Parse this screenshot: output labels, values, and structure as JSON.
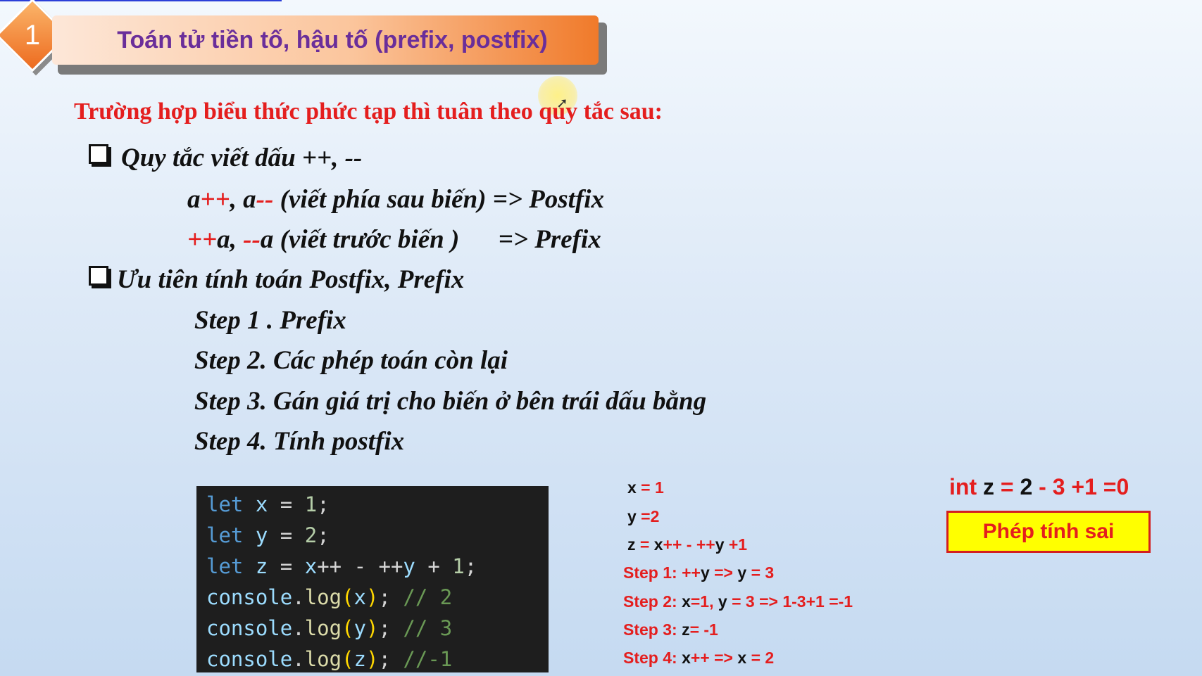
{
  "header": {
    "number": "1",
    "title": "Toán tử tiền tố, hậu tố (prefix, postfix)"
  },
  "intro": "Trường hợp biểu thức phức tạp thì tuân theo quy tắc sau:",
  "rule1": {
    "title": "Quy tắc viết dấu ++, --",
    "postfix": {
      "a1": "a",
      "op1": "++",
      "sep": ", a",
      "op2": "--",
      "desc": " (viết phía sau biến) => Postfix"
    },
    "prefix": {
      "op1": "++",
      "a1": "a, ",
      "op2": "--",
      "desc": "a (viết trước biến )      => Prefix"
    }
  },
  "rule2": {
    "title": "Ưu tiên tính toán Postfix, Prefix",
    "steps": [
      "Step 1 . Prefix",
      "Step 2. Các phép toán còn lại",
      "Step 3. Gán giá trị cho biến ở bên trái dấu bằng",
      "Step 4. Tính postfix"
    ]
  },
  "code": {
    "let": "let",
    "console": "console",
    "log": "log",
    "line1": {
      "var": "x",
      "rest": " = ",
      "num": "1",
      "end": ";"
    },
    "line2": {
      "var": "y",
      "rest": " = ",
      "num": "2",
      "end": ";"
    },
    "line3": {
      "var": "z",
      "expr_a": " = ",
      "x": "x",
      "op1": "++ - ++",
      "y": "y",
      "op2": " + ",
      "num": "1",
      "end": ";"
    },
    "line4": {
      "arg": "x",
      "comment": "// 2"
    },
    "line5": {
      "arg": "y",
      "comment": "// 3"
    },
    "line6": {
      "arg": "z",
      "comment": "//-1"
    }
  },
  "trace": {
    "l1": {
      "a": "x",
      "b": " = 1"
    },
    "l2": {
      "a": "y",
      "b": " =2"
    },
    "l3": {
      "a": "z",
      "b": " = ",
      "c": "x",
      "d": "++ - ++",
      "e": "y",
      "f": " +1"
    },
    "l4": {
      "a": "Step 1: ++",
      "b": "y",
      "c": " => ",
      "d": "y",
      "e": " = 3"
    },
    "l5": {
      "a": "Step 2: ",
      "b": "x",
      "c": "=1, ",
      "d": "y",
      "e": " = 3 => 1-3+1 =-1"
    },
    "l6": {
      "a": "Step 3: ",
      "b": "z",
      "c": "= -1"
    },
    "l7": {
      "a": "Step 4: ",
      "b": "x",
      "c": "++ => ",
      "d": "x",
      "e": " = 2"
    }
  },
  "note": {
    "a": "int ",
    "b": "z",
    "c": " = ",
    "d": "2",
    "e": " - 3 +1 =0"
  },
  "wrong_label": "Phép tính sai",
  "colors": {
    "accent_red": "#e41e1e",
    "title_purple": "#6a2e9a",
    "orange": "#ed6b1f",
    "highlight_yellow": "#ffff00"
  }
}
